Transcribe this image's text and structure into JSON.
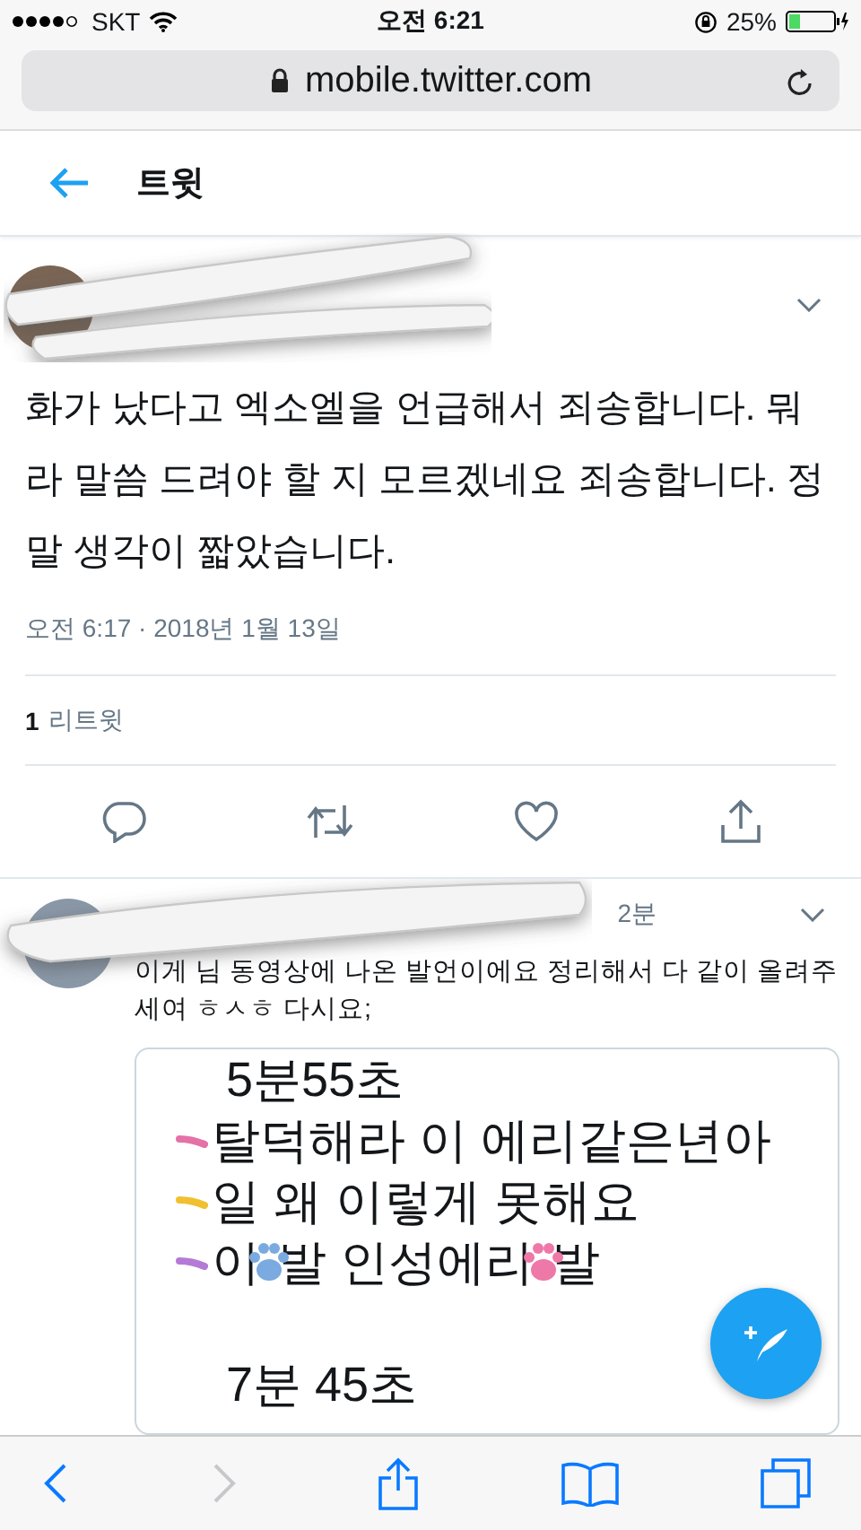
{
  "status_bar": {
    "carrier": "SKT",
    "time": "오전 6:21",
    "battery": "25%"
  },
  "browser": {
    "url": "mobile.twitter.com"
  },
  "header": {
    "title": "트윗"
  },
  "tweet": {
    "text": "화가 났다고 엑소엘을 언급해서 죄송합니다. 뭐라 말씀 드려야 할 지 모르겠네요 죄송합니다. 정말 생각이 짧았습니다.",
    "timestamp": "오전 6:17 · 2018년 1월 13일",
    "retweet_count": "1",
    "retweet_label": "리트윗"
  },
  "reply": {
    "time": "2분",
    "text": "이게 님 동영상에 나온 발언이에요 정리해서 다 같이 올려주세여 ㅎㅅㅎ 다시요;",
    "image_lines": [
      {
        "kind": "heading",
        "parts": [
          {
            "kind": "text",
            "text": "5분55초"
          }
        ]
      },
      {
        "kind": "item",
        "color": "#e472a6",
        "parts": [
          {
            "kind": "text",
            "text": "탈덕해라 이 에리같은년아"
          }
        ]
      },
      {
        "kind": "item",
        "color": "#f0c030",
        "parts": [
          {
            "kind": "text",
            "text": "일 왜 이렇게 못해요"
          }
        ]
      },
      {
        "kind": "item",
        "color": "#b57ad6",
        "parts": [
          {
            "kind": "text",
            "text": "이"
          },
          {
            "kind": "sticker",
            "color": "#7aaae0"
          },
          {
            "kind": "text",
            "text": "발 인성에리 "
          },
          {
            "kind": "sticker",
            "color": "#ee78a8"
          },
          {
            "kind": "text",
            "text": "발"
          }
        ]
      },
      {
        "kind": "heading",
        "parts": [
          {
            "kind": "text",
            "text": "7분 45초"
          }
        ]
      }
    ]
  },
  "toolbar": [
    {
      "kind": "back",
      "disabled": false
    },
    {
      "kind": "forward",
      "disabled": true
    },
    {
      "kind": "share",
      "disabled": false
    },
    {
      "kind": "bookmarks",
      "disabled": false
    },
    {
      "kind": "tabs",
      "disabled": false
    }
  ]
}
